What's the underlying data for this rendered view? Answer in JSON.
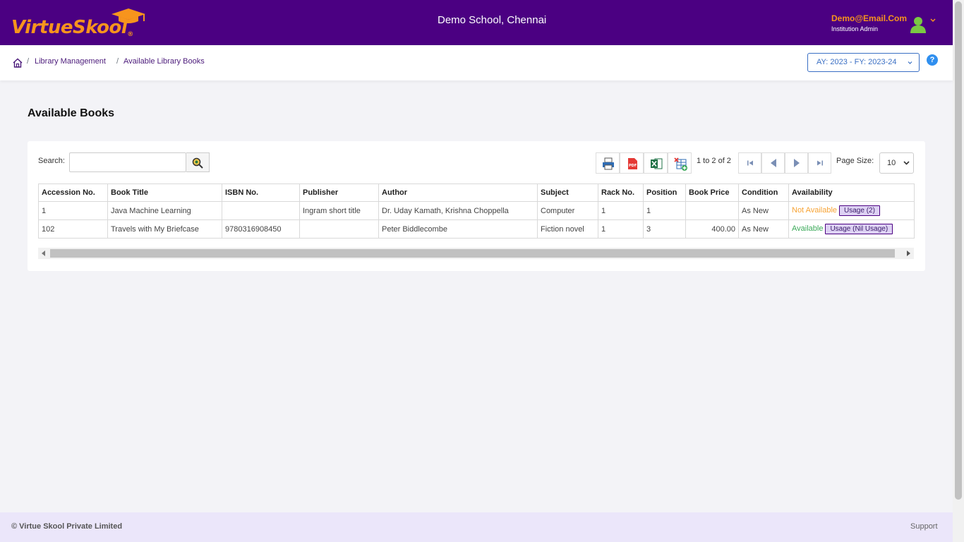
{
  "header": {
    "logo_text_part1": "Virtue",
    "logo_text_part2": "Skool",
    "logo_reg": "®",
    "school": "Demo School, Chennai",
    "user_email": "Demo@Email.Com",
    "user_role": "Institution Admin"
  },
  "breadcrumb": {
    "items": [
      "Library Management",
      "Available Library Books"
    ],
    "separator": "/"
  },
  "year_selector": "AY: 2023 - FY: 2023-24",
  "help": "?",
  "page_title": "Available Books",
  "toolbar": {
    "search_label": "Search:",
    "search_value": "",
    "pager_text": "1 to 2 of 2",
    "page_size_label": "Page Size:",
    "page_size_value": "10"
  },
  "table": {
    "columns": [
      "Accession No.",
      "Book Title",
      "ISBN No.",
      "Publisher",
      "Author",
      "Subject",
      "Rack No.",
      "Position",
      "Book Price",
      "Condition",
      "Availability"
    ],
    "rows": [
      {
        "accession": "1",
        "title": "Java Machine Learning",
        "isbn": "",
        "publisher": "Ingram short title",
        "author": "Dr. Uday Kamath, Krishna Choppella",
        "subject": "Computer",
        "rack": "1",
        "position": "1",
        "price": "",
        "condition": "As New",
        "availability": "Not Available",
        "usage": "Usage (2)"
      },
      {
        "accession": "102",
        "title": "Travels with My Briefcase",
        "isbn": "9780316908450",
        "publisher": "",
        "author": "Peter Biddlecombe",
        "subject": "Fiction novel",
        "rack": "1",
        "position": "3",
        "price": "400.00",
        "condition": "As New",
        "availability": "Available",
        "usage": "Usage (Nil Usage)"
      }
    ]
  },
  "footer": {
    "copyright": "© Virtue Skool Private Limited",
    "support": "Support"
  },
  "colors": {
    "header_bg": "#4b0082",
    "brand_orange": "#f7941d",
    "not_available": "#f7a334",
    "available": "#3caa5a",
    "footer_bg": "#ebe6fa"
  }
}
